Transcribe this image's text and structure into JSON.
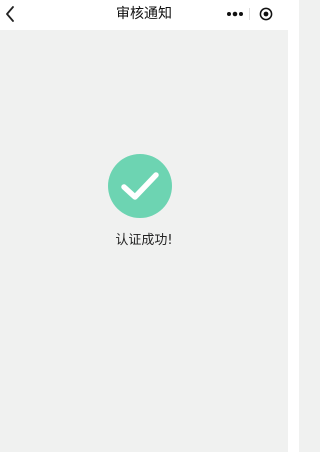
{
  "nav": {
    "title": "审核通知"
  },
  "status": {
    "message": "认证成功!",
    "icon": "check-circle-icon",
    "color": "#6dd4b2"
  }
}
